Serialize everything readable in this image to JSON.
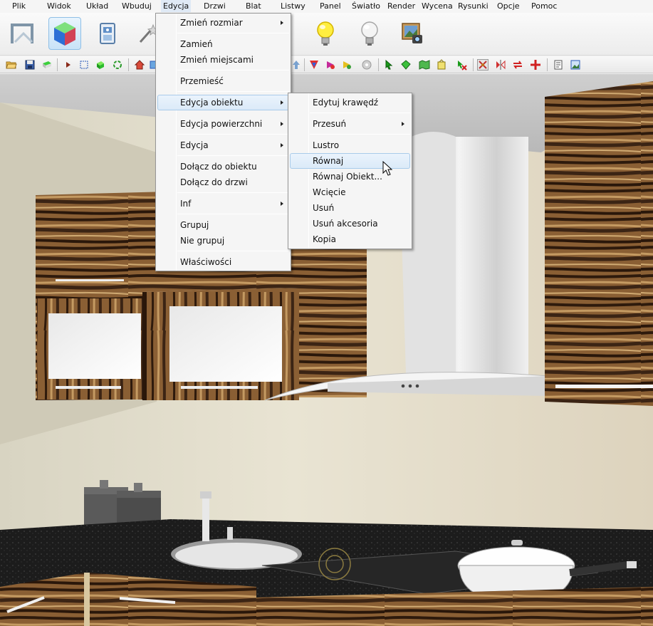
{
  "menubar": {
    "items": [
      {
        "label": "Plik"
      },
      {
        "label": "Widok"
      },
      {
        "label": "Układ"
      },
      {
        "label": "Wbuduj"
      },
      {
        "label": "Edycja"
      },
      {
        "label": "Drzwi"
      },
      {
        "label": "Blat"
      },
      {
        "label": "Listwy"
      },
      {
        "label": "Panel"
      },
      {
        "label": "Światło"
      },
      {
        "label": "Render"
      },
      {
        "label": "Wycena"
      },
      {
        "label": "Rysunki"
      },
      {
        "label": "Opcje"
      },
      {
        "label": "Pomoc"
      }
    ],
    "active": "Edycja"
  },
  "main_toolbar": {
    "icons": [
      "room-outline-icon",
      "cube-3d-icon",
      "cabinet-view-icon",
      "wand-icon",
      "bulb-on-icon",
      "bulb-off-icon",
      "render-photo-icon"
    ],
    "selected": "cube-3d-icon"
  },
  "edit_menu": {
    "items": [
      {
        "label": "Zmień rozmiar",
        "submenu": true
      },
      {
        "label": "Zamień",
        "submenu": false
      },
      {
        "label": "Zmień miejscami",
        "submenu": false
      },
      {
        "label": "Przemieść",
        "submenu": false
      },
      {
        "label": "Edycja obiektu",
        "submenu": true,
        "highlighted": true
      },
      {
        "label": "Edycja powierzchni",
        "submenu": true
      },
      {
        "label": "Edycja",
        "submenu": true
      },
      {
        "label": "Dołącz do obiektu",
        "submenu": false
      },
      {
        "label": "Dołącz do drzwi",
        "submenu": false
      },
      {
        "label": "Inf",
        "submenu": true
      },
      {
        "label": "Grupuj",
        "submenu": false
      },
      {
        "label": "Nie grupuj",
        "submenu": false
      },
      {
        "label": "Właściwości",
        "submenu": false
      }
    ]
  },
  "object_submenu": {
    "items": [
      {
        "label": "Edytuj krawędź",
        "submenu": false
      },
      {
        "label": "Przesuń",
        "submenu": true
      },
      {
        "label": "Lustro",
        "submenu": false
      },
      {
        "label": "Równaj",
        "submenu": false,
        "highlighted": true
      },
      {
        "label": "Równaj Obiekt...",
        "submenu": false
      },
      {
        "label": "Wcięcie",
        "submenu": false
      },
      {
        "label": "Usuń",
        "submenu": false
      },
      {
        "label": "Usuń akcesoria",
        "submenu": false
      },
      {
        "label": "Kopia",
        "submenu": false
      }
    ]
  },
  "colors": {
    "wood_dark": "#3b2414",
    "wood_light": "#b88a55",
    "wall": "#e6e0cf",
    "countertop": "#1c1c1c",
    "menu_highlight": "#dbeaf8"
  }
}
